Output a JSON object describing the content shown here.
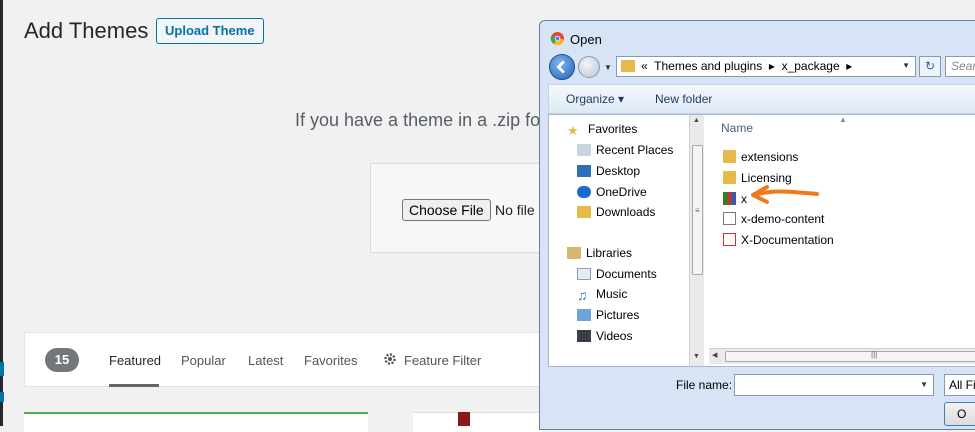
{
  "wp": {
    "page_title": "Add Themes",
    "upload_button": "Upload Theme",
    "zip_text": "If you have a theme in a .zip for",
    "choose_file": "Choose File",
    "no_file": "No file",
    "count": "15",
    "filters": [
      "Featured",
      "Popular",
      "Latest",
      "Favorites"
    ],
    "feature_filter": "Feature Filter"
  },
  "dialog": {
    "title": "Open",
    "breadcrumb_prefix": "«",
    "breadcrumb": [
      "Themes and plugins",
      "x_package"
    ],
    "search_placeholder": "Sear",
    "toolbar": {
      "organize": "Organize",
      "new_folder": "New folder"
    },
    "nav": {
      "favorites": "Favorites",
      "favorites_items": [
        "Recent Places",
        "Desktop",
        "OneDrive",
        "Downloads"
      ],
      "libraries": "Libraries",
      "libraries_items": [
        "Documents",
        "Music",
        "Pictures",
        "Videos"
      ]
    },
    "column_name": "Name",
    "files": [
      {
        "name": "extensions",
        "icon": "folder-icon"
      },
      {
        "name": "Licensing",
        "icon": "folder-icon"
      },
      {
        "name": "x",
        "icon": "rar-archive-icon"
      },
      {
        "name": "x-demo-content",
        "icon": "xml-file-icon"
      },
      {
        "name": "X-Documentation",
        "icon": "pdf-file-icon"
      }
    ],
    "file_name_label": "File name:",
    "file_type": "All Fil",
    "open_button": "O"
  },
  "colors": {
    "wp_blue": "#0073aa",
    "annotation_arrow": "#f07a1a"
  }
}
